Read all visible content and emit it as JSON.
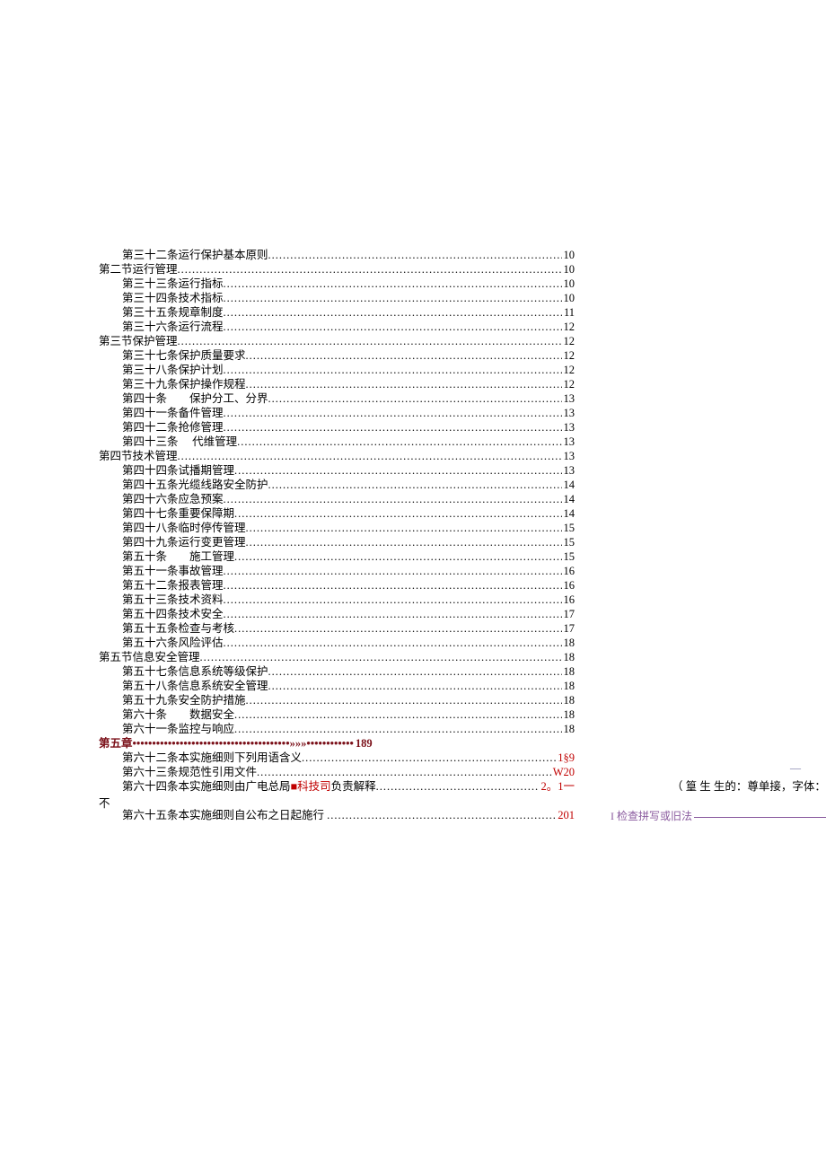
{
  "toc": [
    {
      "indent": 1,
      "label": "第三十二条运行保护基本原则",
      "page": "10"
    },
    {
      "indent": 0,
      "label": "第二节运行管理",
      "page": "10"
    },
    {
      "indent": 1,
      "label": "第三十三条运行指标",
      "page": "10"
    },
    {
      "indent": 1,
      "label": "第三十四条技术指标",
      "page": "10"
    },
    {
      "indent": 1,
      "label": "第三十五条规章制度",
      "page": "11"
    },
    {
      "indent": 1,
      "label": "第三十六条运行流程",
      "page": "12"
    },
    {
      "indent": 0,
      "label": "第三节保护管理",
      "page": "12"
    },
    {
      "indent": 1,
      "label": "第三十七条保护质量要求",
      "page": "12"
    },
    {
      "indent": 1,
      "label": "第三十八条保护计划",
      "page": "12"
    },
    {
      "indent": 1,
      "label": "第三十九条保护操作规程",
      "page": "12"
    },
    {
      "indent": 1,
      "label": "第四十条　　保护分工、分界",
      "page": "13"
    },
    {
      "indent": 1,
      "label": "第四十一条备件管理",
      "page": "13"
    },
    {
      "indent": 1,
      "label": "第四十二条抢修管理",
      "page": "13"
    },
    {
      "indent": 1,
      "label": "第四十三条　 代维管理",
      "page": "13"
    },
    {
      "indent": 0,
      "label": "第四节技术管理",
      "page": "13"
    },
    {
      "indent": 1,
      "label": "第四十四条试播期管理",
      "page": "13"
    },
    {
      "indent": 1,
      "label": "第四十五条光缆线路安全防护",
      "page": "14"
    },
    {
      "indent": 1,
      "label": "第四十六条应急预案",
      "page": "14"
    },
    {
      "indent": 1,
      "label": "第四十七条重要保障期",
      "page": "14"
    },
    {
      "indent": 1,
      "label": "第四十八条临时停传管理",
      "page": "15"
    },
    {
      "indent": 1,
      "label": "第四十九条运行变更管理",
      "page": "15"
    },
    {
      "indent": 1,
      "label": "第五十条　　施工管理",
      "page": "15"
    },
    {
      "indent": 1,
      "label": "第五十一条事故管理",
      "page": "16"
    },
    {
      "indent": 1,
      "label": "第五十二条报表管理",
      "page": "16"
    },
    {
      "indent": 1,
      "label": "第五十三条技术资料",
      "page": "16"
    },
    {
      "indent": 1,
      "label": "第五十四条技术安全",
      "page": "17"
    },
    {
      "indent": 1,
      "label": "第五十五条检查与考核",
      "page": "17"
    },
    {
      "indent": 1,
      "label": "第五十六条风险评估",
      "page": "18"
    },
    {
      "indent": 0,
      "label": "第五节信息安全管理",
      "page": "18"
    },
    {
      "indent": 1,
      "label": "第五十七条信息系统等级保护",
      "page": "18"
    },
    {
      "indent": 1,
      "label": "第五十八条信息系统安全管理",
      "page": "18"
    },
    {
      "indent": 1,
      "label": "第五十九条安全防护措施",
      "page": "18"
    },
    {
      "indent": 1,
      "label": "第六十条　　数据安全",
      "page": "18"
    },
    {
      "indent": 1,
      "label": "第六十一条监控与响应",
      "page": "18"
    }
  ],
  "chapter": {
    "prefix": "第五章",
    "fill": "••••••••••••••••••••••••••••••••••••••••»»»••••••••••••",
    "page": "189"
  },
  "after": [
    {
      "indent": 1,
      "label": "第六十二条本实施细则下列用语含义",
      "page": "1§9",
      "pageRed": true
    },
    {
      "indent": 1,
      "label": "第六十三条规范性引用文件",
      "page": "W20",
      "pageRed": true
    }
  ],
  "special64": {
    "label_a": "第六十四条本实施细则由广电总局",
    "mark": "■",
    "label_b": "科技司",
    "label_c": "负责解释",
    "page": "2。1一",
    "tail": "（ 篁 生 生的：尊单接，字体：宋体，五号，非船斜，"
  },
  "wrap_bu": "不",
  "row65": {
    "label": "第六十五条本实施细则自公布之日起施行",
    "page": "201"
  },
  "sidenote": "I 检查拼写或旧法",
  "dash": "—"
}
